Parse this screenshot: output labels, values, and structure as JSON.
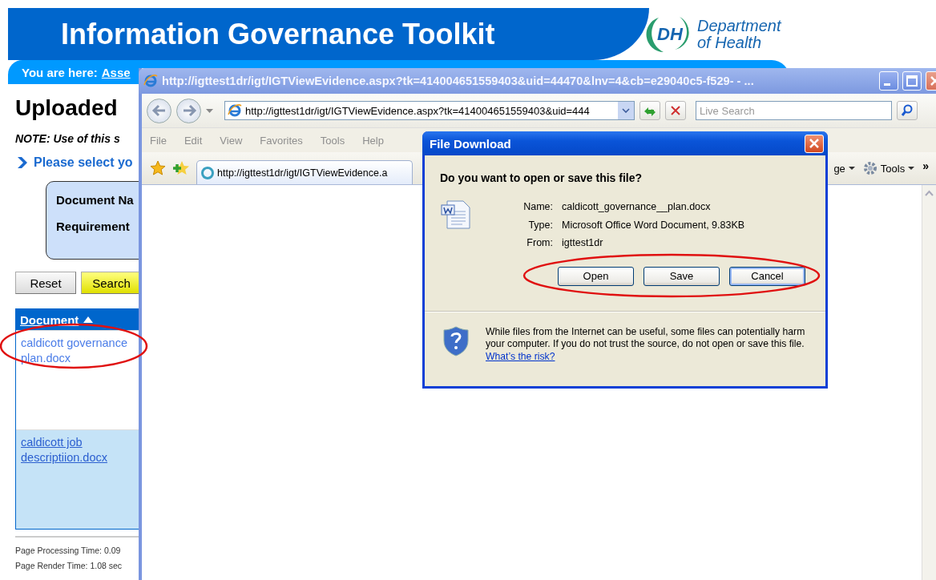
{
  "page": {
    "banner": {
      "title": "Information Governance Toolkit",
      "logo_mark": "DH",
      "logo_lines": [
        "Department",
        "of Health"
      ]
    },
    "breadcrumb": {
      "label": "You are here:",
      "link": "Asse"
    },
    "heading": "Uploaded",
    "note": "NOTE: Use of this s",
    "instruction": "Please select yo",
    "filters": [
      {
        "label": "Document Na"
      },
      {
        "label": "Requirement"
      }
    ],
    "buttons": [
      {
        "label": "Reset",
        "kind": "plain"
      },
      {
        "label": "Search",
        "kind": "primary"
      }
    ],
    "table": {
      "column": "Document",
      "rows": [
        {
          "file": "caldicott governance plan.docx",
          "kind": "plain"
        },
        {
          "file": "caldicott job descriptiion.docx",
          "kind": "alt"
        }
      ]
    },
    "footer": [
      "Page Processing Time: 0.09",
      "Page Render Time: 1.08 sec"
    ]
  },
  "browser": {
    "title": "http://igttest1dr/igt/IGTViewEvidence.aspx?tk=414004651559403&uid=44470&lnv=4&cb=e29040c5-f529- - ...",
    "address": "http://igttest1dr/igt/IGTViewEvidence.aspx?tk=414004651559403&uid=444",
    "search_placeholder": "Live Search",
    "menu": [
      "File",
      "Edit",
      "View",
      "Favorites",
      "Tools",
      "Help"
    ],
    "tab": "http://igttest1dr/igt/IGTViewEvidence.a",
    "commands": [
      {
        "label": "ge",
        "kind": "page"
      },
      {
        "label": "Tools",
        "kind": "tools"
      }
    ],
    "overflow": "»"
  },
  "dialog": {
    "title": "File Download",
    "question": "Do you want to open or save this file?",
    "fields": [
      {
        "label": "Name:",
        "value": "caldicott_governance__plan.docx"
      },
      {
        "label": "Type:",
        "value": "Microsoft Office Word Document, 9.83KB"
      },
      {
        "label": "From:",
        "value": "igttest1dr"
      }
    ],
    "buttons": [
      {
        "label": "Open",
        "default": false
      },
      {
        "label": "Save",
        "default": false
      },
      {
        "label": "Cancel",
        "default": true
      }
    ],
    "warning": "While files from the Internet can be useful, some files can potentially harm your computer. If you do not trust the source, do not open or save this file.",
    "risk_link": "What’s the risk?"
  }
}
